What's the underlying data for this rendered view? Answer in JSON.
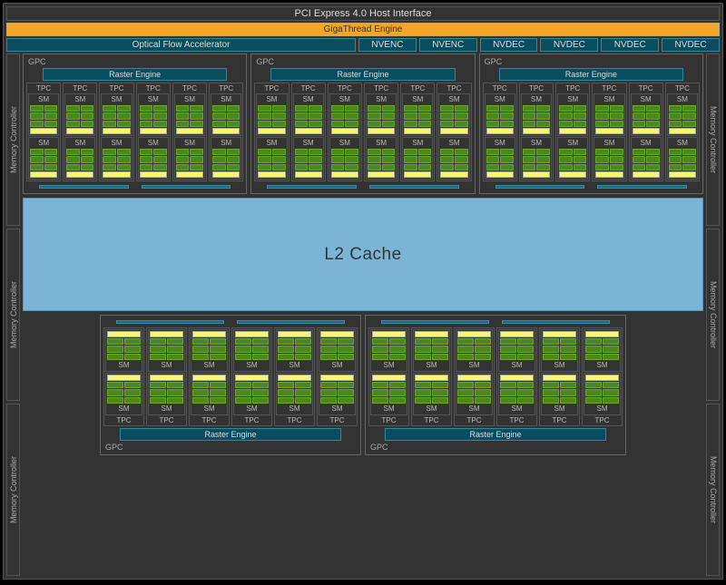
{
  "host_interface": "PCI Express 4.0 Host Interface",
  "gigathread": "GigaThread Engine",
  "ofa": "Optical Flow Accelerator",
  "encoders": [
    "NVENC",
    "NVENC",
    "NVDEC",
    "NVDEC",
    "NVDEC",
    "NVDEC"
  ],
  "gpc_label": "GPC",
  "raster_engine": "Raster Engine",
  "tpc_label": "TPC",
  "sm_label": "SM",
  "l2_cache": "L2 Cache",
  "memory_controller": "Memory Controller",
  "top_gpcs": 3,
  "bottom_gpcs": 2,
  "tpcs_per_gpc": 6,
  "sms_per_tpc": 2,
  "left_mc_count": 3,
  "right_mc_count": 3
}
